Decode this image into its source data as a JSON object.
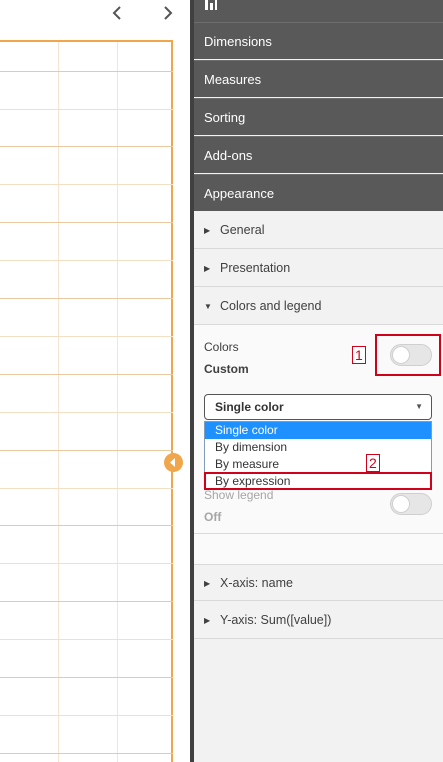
{
  "canvas": {
    "nav_prev_icon": "chevron-left-icon",
    "nav_next_icon": "chevron-right-icon",
    "resize_handle_icon": "caret-left-icon",
    "accent_color": "#f0a64a"
  },
  "panel": {
    "sections": [
      "Dimensions",
      "Measures",
      "Sorting",
      "Add-ons",
      "Appearance"
    ],
    "appearance_items": {
      "general": "General",
      "presentation": "Presentation",
      "colors_legend": "Colors and legend",
      "x_axis": "X-axis: name",
      "y_axis": "Y-axis: Sum([value])"
    },
    "colors": {
      "label": "Colors",
      "mode": "Custom",
      "toggle_on": false
    },
    "color_select": {
      "selected": "Single color",
      "options": [
        "Single color",
        "By dimension",
        "By measure",
        "By expression"
      ],
      "highlighted_option": "Single color"
    },
    "legend": {
      "label": "Show legend",
      "value": "Off",
      "toggle_on": false
    }
  },
  "annotations": {
    "marker_1": "1",
    "marker_2": "2",
    "color": "#d0021b"
  }
}
